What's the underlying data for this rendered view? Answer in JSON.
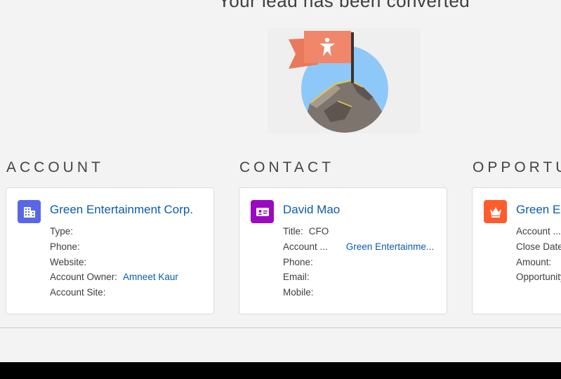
{
  "headline": "Your lead has been converted",
  "colors": {
    "account_icon": "#5867e8",
    "contact_icon": "#9a0ac1",
    "opportunity_icon": "#fe5c2c",
    "link": "#0b5cab",
    "flag": "#f0866a",
    "sky": "#8ec8f8"
  },
  "sections": {
    "account": {
      "title": "ACCOUNT",
      "icon": "building-icon",
      "name": "Green Entertainment Corp.",
      "fields": [
        {
          "label": "Type:",
          "value": ""
        },
        {
          "label": "Phone:",
          "value": ""
        },
        {
          "label": "Website:",
          "value": ""
        },
        {
          "label": "Account Owner:",
          "value": "Amneet Kaur"
        },
        {
          "label": "Account Site:",
          "value": ""
        }
      ]
    },
    "contact": {
      "title": "CONTACT",
      "icon": "contact-card-icon",
      "name": "David Mao",
      "fields": [
        {
          "label": "Title:",
          "value": "CFO"
        },
        {
          "label": "Account ...",
          "value": "Green Entertainme..."
        },
        {
          "label": "Phone:",
          "value": ""
        },
        {
          "label": "Email:",
          "value": ""
        },
        {
          "label": "Mobile:",
          "value": ""
        }
      ]
    },
    "opportunity": {
      "title": "OPPORTUNITY",
      "icon": "crown-icon",
      "name": "Green Entertainment Corp.-",
      "fields": [
        {
          "label": "Account ...",
          "value": ""
        },
        {
          "label": "Close Date:",
          "value": ""
        },
        {
          "label": "Amount:",
          "value": ""
        },
        {
          "label": "Opportunity Owner:",
          "value": ""
        }
      ]
    }
  }
}
